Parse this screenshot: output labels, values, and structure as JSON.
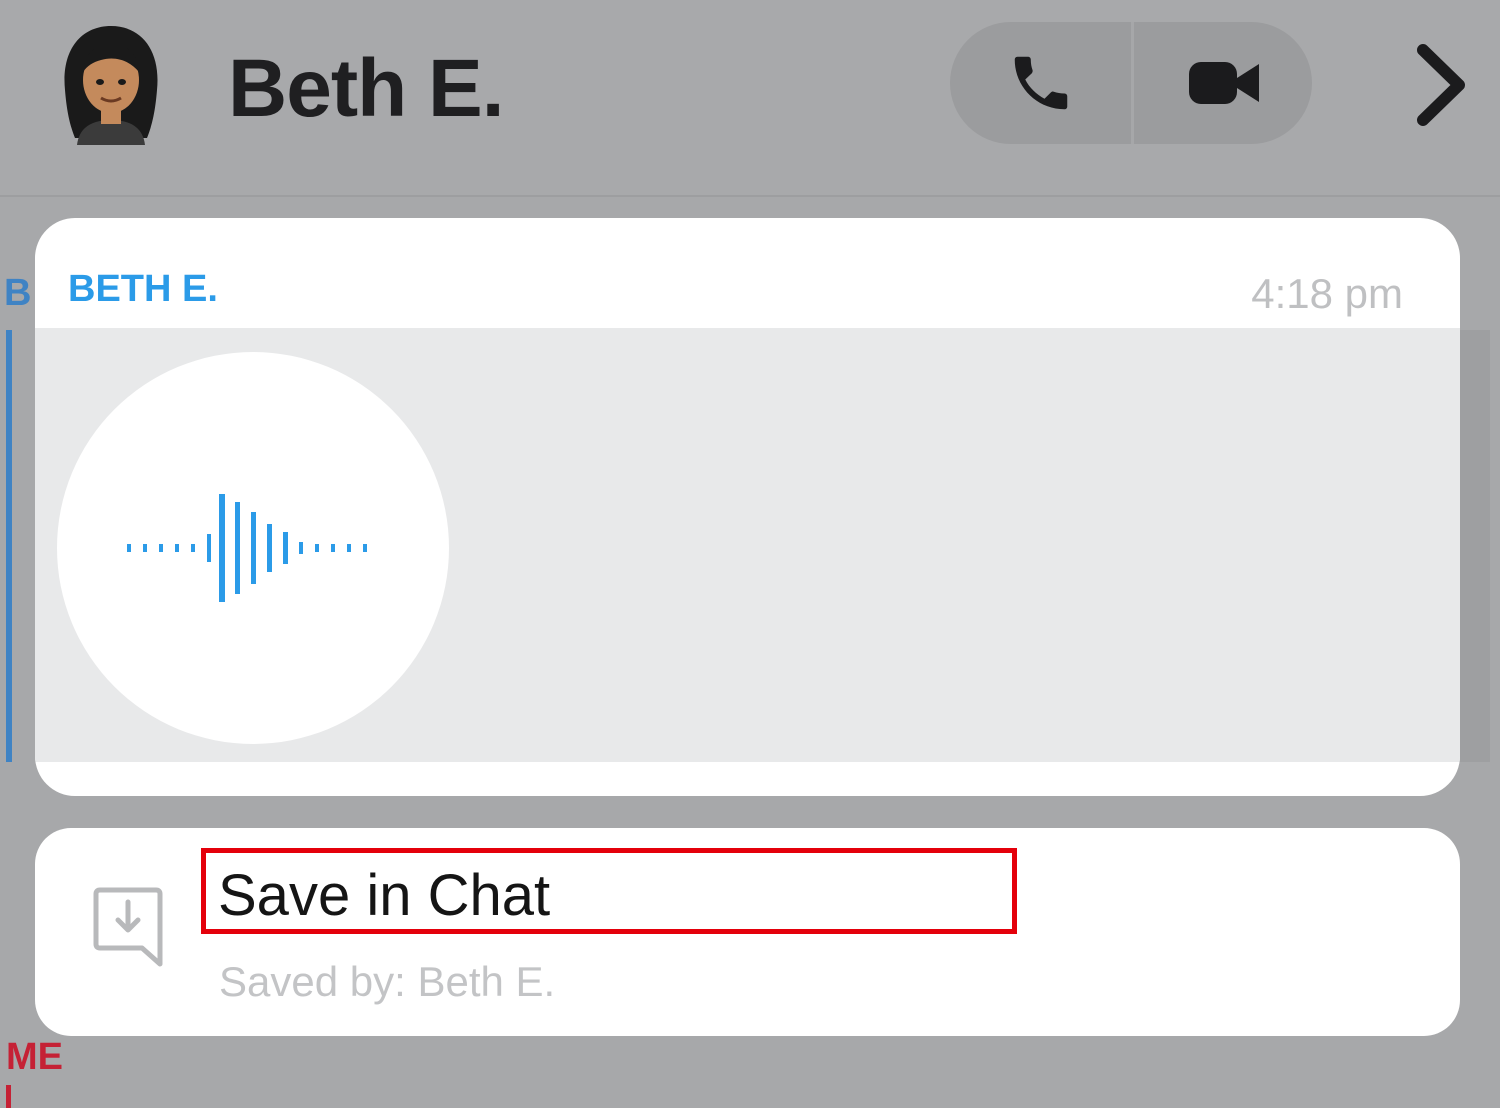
{
  "header": {
    "contact_name": "Beth E.",
    "voice_call_icon": "phone-icon",
    "video_call_icon": "video-camera-icon",
    "forward_icon": "chevron-right-icon"
  },
  "message": {
    "sender": "BETH E.",
    "time": "4:18 pm",
    "type_icon": "audio-waveform-icon"
  },
  "actions": {
    "save_label": "Save in Chat",
    "saved_by": "Saved by: Beth E.",
    "icon": "save-in-chat-icon"
  },
  "background": {
    "left_sender_initial": "B",
    "me_label": "ME"
  },
  "colors": {
    "sender_blue": "#2b9be8",
    "highlight_red": "#e4000b",
    "me_red": "#c52135"
  }
}
